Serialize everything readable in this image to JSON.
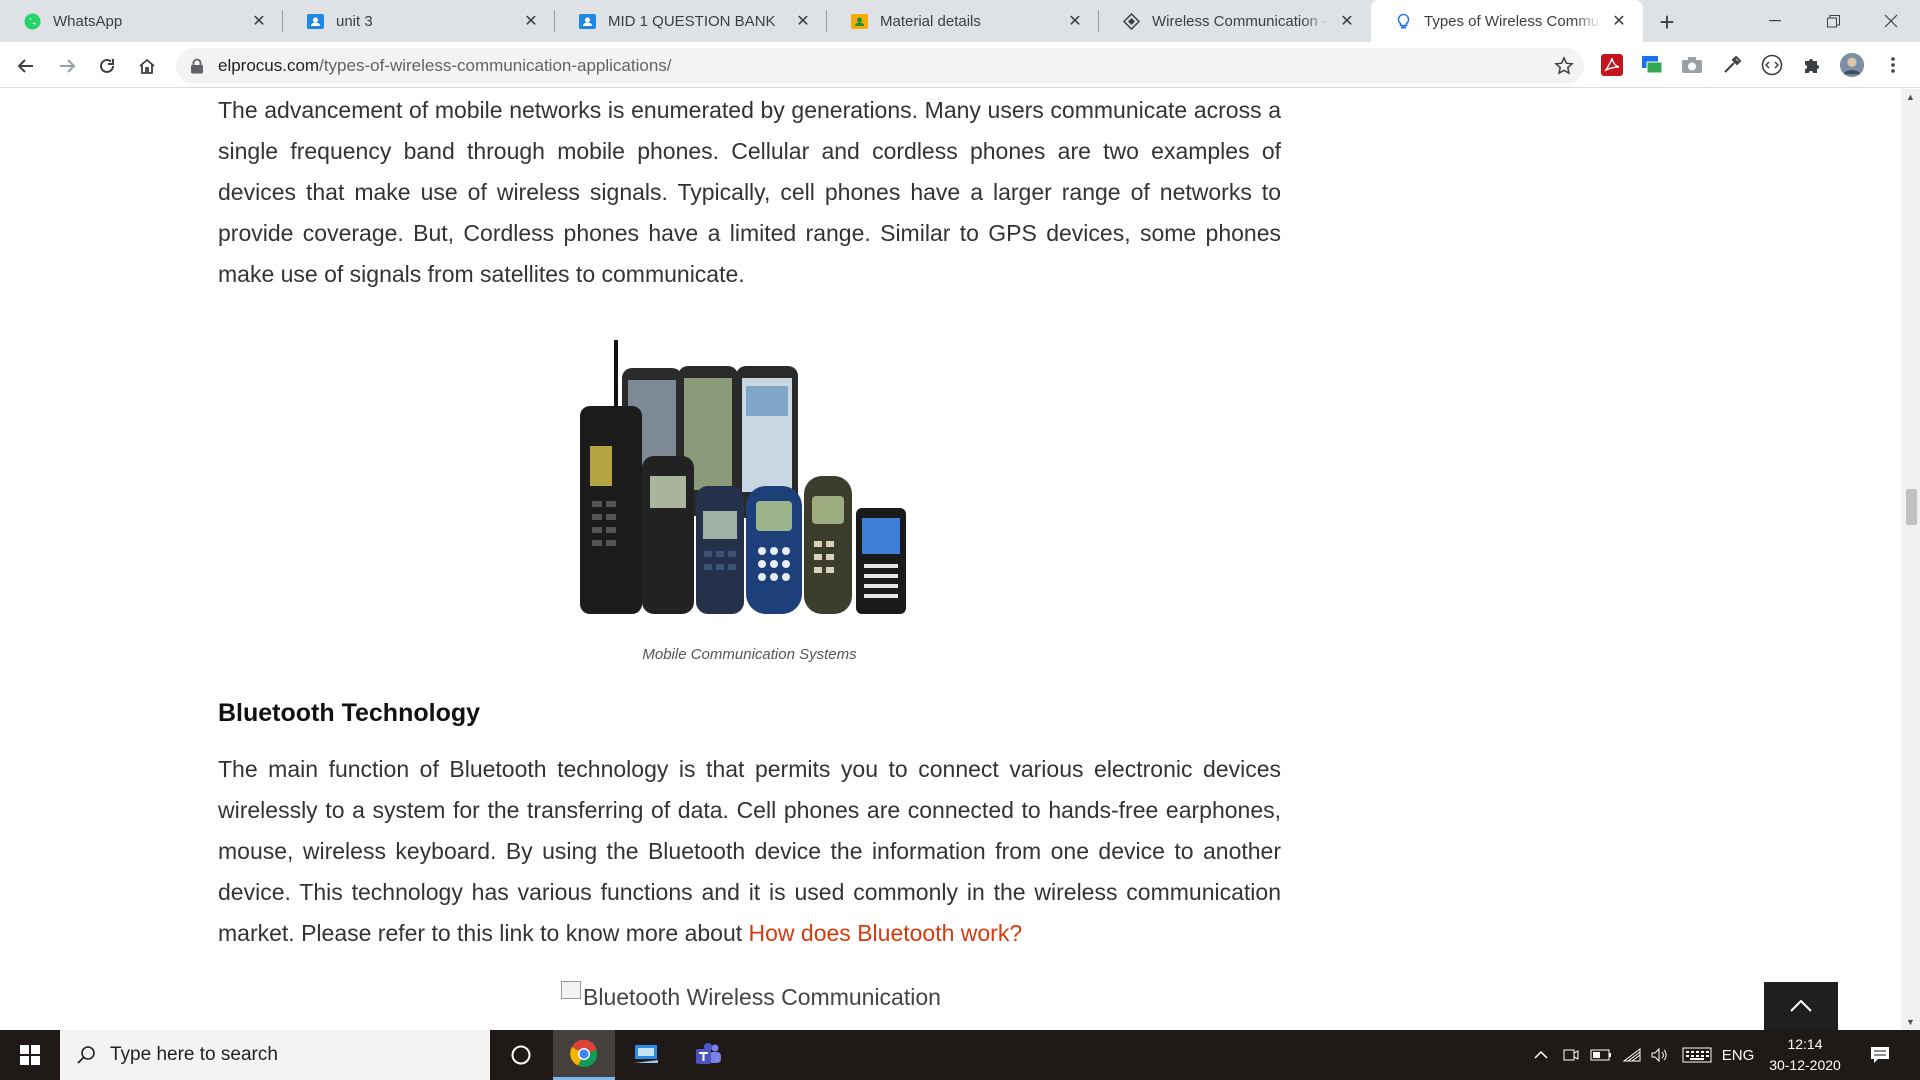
{
  "browser": {
    "tabs": [
      {
        "title": "WhatsApp",
        "icon": "whatsapp-icon",
        "active": false
      },
      {
        "title": "unit 3",
        "icon": "google-classroom-icon",
        "active": false
      },
      {
        "title": "MID 1 QUESTION BANK",
        "icon": "google-classroom-icon",
        "active": false
      },
      {
        "title": "Material details",
        "icon": "google-classroom-icon",
        "active": false
      },
      {
        "title": "Wireless Communication - O",
        "icon": "site-diamond-icon",
        "active": false
      },
      {
        "title": "Types of Wireless Communic",
        "icon": "lightbulb-icon",
        "active": true
      }
    ],
    "url_domain": "elprocus.com",
    "url_path": "/types-of-wireless-communication-applications/"
  },
  "article": {
    "paragraph_mobile": "The advancement of mobile networks is enumerated by generations. Many users communicate across a single frequency band through mobile phones. Cellular and cordless phones are two examples of devices that make use of wireless signals. Typically, cell phones have a larger range of networks to provide coverage. But, Cordless phones have a limited range. Similar to GPS devices, some phones make use of signals from satellites to communicate.",
    "figure_caption": "Mobile Communication Systems",
    "heading_bluetooth": "Bluetooth Technology",
    "paragraph_bluetooth": "The main function of Bluetooth technology is that permits you to connect various electronic devices wirelessly to a system for the transferring of data. Cell phones are connected to hands-free earphones, mouse, wireless keyboard. By using the Bluetooth device the information from one device to another device. This technology has various functions and it is used commonly in the wireless communication market. Please refer to this link to know more about",
    "bluetooth_link": "How does Bluetooth work?",
    "broken_image_alt": "Bluetooth Wireless Communication"
  },
  "taskbar": {
    "search_placeholder": "Type here to search",
    "language": "ENG",
    "time": "12:14",
    "date": "30-12-2020"
  },
  "colors": {
    "link": "#d53b0c",
    "tabstrip": "#dee1e6",
    "taskbar": "#1f1a17"
  }
}
